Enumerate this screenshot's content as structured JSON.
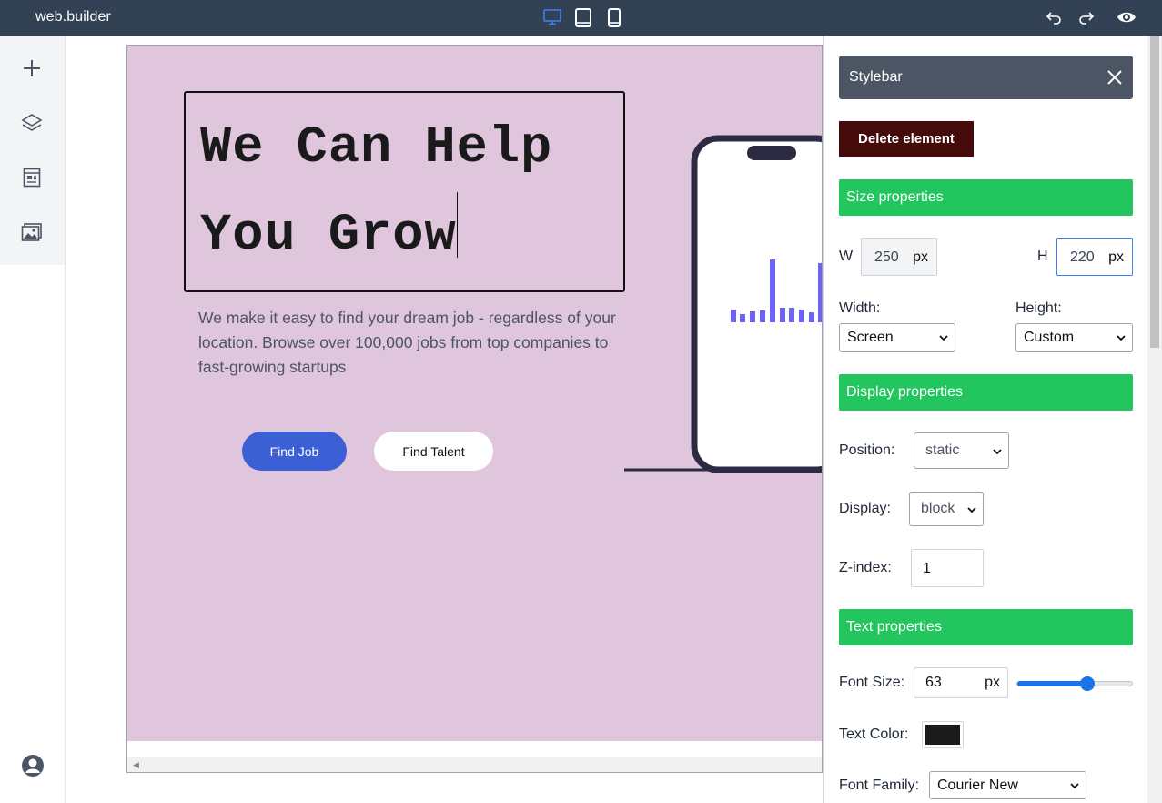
{
  "app": {
    "brand": "web.builder"
  },
  "colors": {
    "topbar": "#334155",
    "canvas_bg": "#e0c6dc",
    "accent_blue": "#3b5fd4",
    "section_green": "#22c55e",
    "delete_bg": "#450a0a",
    "device_active": "#3b82f6"
  },
  "devices": [
    {
      "icon": "desktop-icon",
      "active": true
    },
    {
      "icon": "tablet-icon",
      "active": false
    },
    {
      "icon": "mobile-icon",
      "active": false
    }
  ],
  "toolbar_right": [
    "undo-icon",
    "redo-icon",
    "preview-eye-icon"
  ],
  "left_tools": [
    "add-icon",
    "layers-icon",
    "pages-icon",
    "media-icon"
  ],
  "canvas": {
    "headline_line1": "We Can Help",
    "headline_line2": "You Grow",
    "subtext": "We make it easy to find your dream job - regardless of your location. Browse over 100,000 jobs from top companies to fast-growing startups",
    "btn_find_job": "Find Job",
    "btn_find_talent": "Find Talent"
  },
  "stylebar": {
    "title": "Stylebar",
    "delete_label": "Delete element",
    "size_section": "Size properties",
    "w_label": "W",
    "w_value": "250",
    "w_unit": "px",
    "h_label": "H",
    "h_value": "220",
    "h_unit": "px",
    "width_label": "Width:",
    "width_value": "Screen",
    "height_label": "Height:",
    "height_value": "Custom",
    "display_section": "Display properties",
    "position_label": "Position:",
    "position_value": "static",
    "display_label": "Display:",
    "display_value": "block",
    "zindex_label": "Z-index:",
    "zindex_value": "1",
    "text_section": "Text properties",
    "font_size_label": "Font Size:",
    "font_size_value": "63",
    "font_size_unit": "px",
    "font_size_slider": 0.6,
    "text_color_label": "Text Color:",
    "text_color_value": "#1a1a1a",
    "font_family_label": "Font Family:",
    "font_family_value": "Courier New"
  }
}
